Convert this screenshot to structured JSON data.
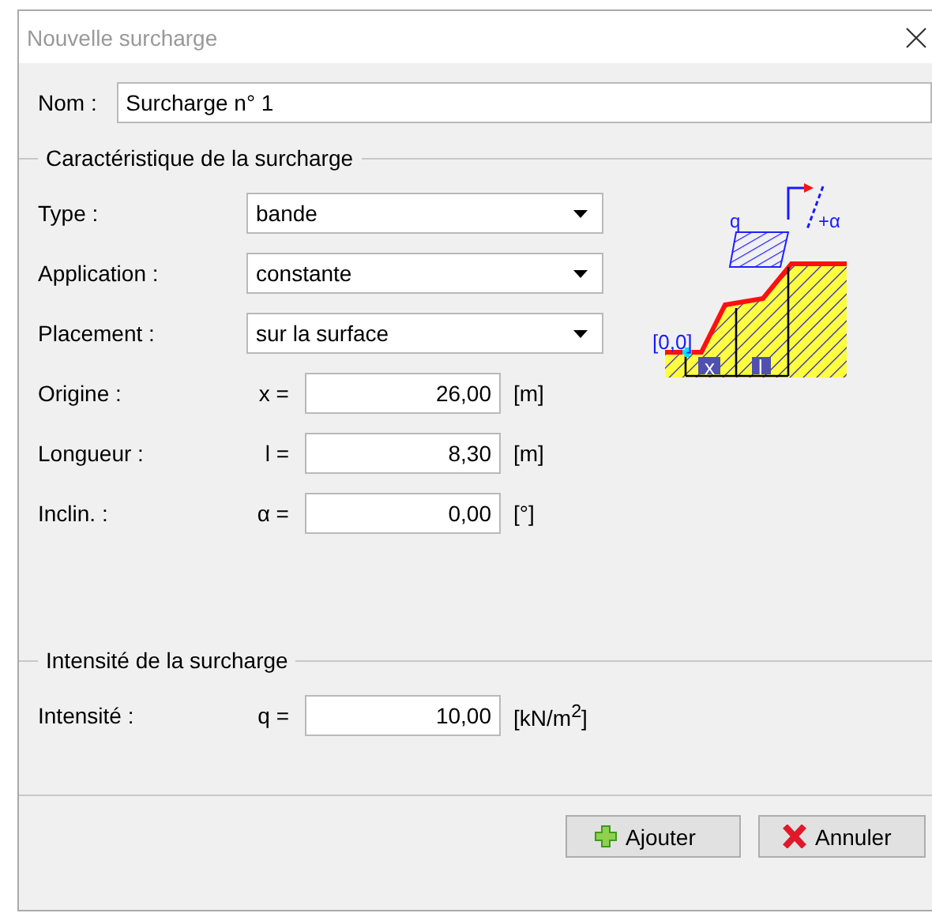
{
  "window": {
    "title": "Nouvelle surcharge"
  },
  "name_field": {
    "label": "Nom :",
    "value": "Surcharge n° 1"
  },
  "characteristics": {
    "title": "Caractéristique de la surcharge",
    "selects": [
      {
        "label": "Type :",
        "value": "bande"
      },
      {
        "label": "Application :",
        "value": "constante"
      },
      {
        "label": "Placement :",
        "value": "sur la surface"
      }
    ],
    "fields": [
      {
        "label": "Origine :",
        "symbol": "x =",
        "value": "26,00",
        "unit": "[m]"
      },
      {
        "label": "Longueur :",
        "symbol": "l =",
        "value": "8,30",
        "unit": "[m]"
      },
      {
        "label": "Inclin. :",
        "symbol": "α =",
        "value": "0,00",
        "unit": "[°]"
      }
    ],
    "diagram": {
      "labels": [
        {
          "kind": "load",
          "text": "q"
        },
        {
          "kind": "angle",
          "text": "+α"
        },
        {
          "kind": "origin",
          "text": "[0,0]"
        },
        {
          "kind": "x",
          "text": "x"
        },
        {
          "kind": "length",
          "text": "l"
        }
      ]
    }
  },
  "intensity": {
    "title": "Intensité de la surcharge",
    "fields": [
      {
        "label": "Intensité :",
        "symbol": "q =",
        "value": "10,00",
        "unit": "[kN/m$^{2}$]"
      }
    ]
  },
  "buttons": [
    {
      "kind": "add",
      "label": "Ajouter"
    },
    {
      "kind": "cancel",
      "label": "Annuler"
    }
  ]
}
